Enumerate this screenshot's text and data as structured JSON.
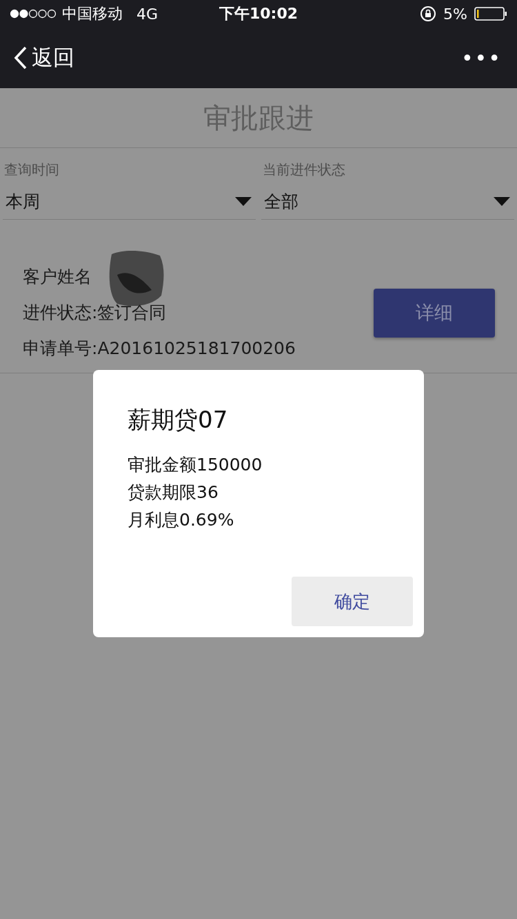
{
  "status_bar": {
    "carrier": "中国移动",
    "network": "4G",
    "time": "下午10:02",
    "battery": "5%"
  },
  "nav": {
    "back": "返回",
    "more": "•••"
  },
  "title": "审批跟进",
  "filters": [
    {
      "label": "查询时间",
      "value": "本周"
    },
    {
      "label": "当前进件状态",
      "value": "全部"
    }
  ],
  "record": {
    "lines": [
      "客户姓名",
      "进件状态:签订合同",
      "申请单号:A20161025181700206"
    ],
    "button": "详细"
  },
  "dialog": {
    "title": "薪期贷07",
    "lines": [
      "审批金额150000",
      "贷款期限36",
      "月利息0.69%"
    ],
    "button": "确定"
  }
}
